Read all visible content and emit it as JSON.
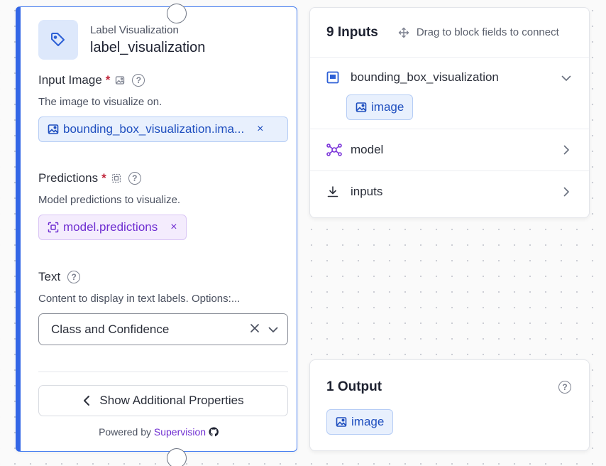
{
  "block": {
    "type_label": "Label Visualization",
    "name": "label_visualization",
    "fields": {
      "input_image": {
        "label": "Input Image",
        "required_mark": "*",
        "description": "The image to visualize on.",
        "value": "bounding_box_visualization.ima...",
        "remove": "×"
      },
      "predictions": {
        "label": "Predictions",
        "required_mark": "*",
        "description": "Model predictions to visualize.",
        "value": "model.predictions",
        "remove": "×"
      },
      "text": {
        "label": "Text",
        "description": "Content to display in text labels. Options:...",
        "value": "Class and Confidence"
      }
    },
    "help_glyph": "?",
    "show_more_label": "Show Additional Properties",
    "powered_by_prefix": "Powered by",
    "powered_by_name": "Supervision"
  },
  "inputs_panel": {
    "title": "9 Inputs",
    "hint": "Drag to block fields to connect",
    "rows": [
      {
        "label": "bounding_box_visualization",
        "icon": "image-icon",
        "expanded": true,
        "chip": "image"
      },
      {
        "label": "model",
        "icon": "model-graph-icon",
        "expanded": false
      },
      {
        "label": "inputs",
        "icon": "download-icon",
        "expanded": false
      }
    ]
  },
  "output_panel": {
    "title": "1 Output",
    "chip": "image"
  },
  "colors": {
    "accent_blue": "#3366e6",
    "chip_blue_text": "#1f4fbf",
    "chip_purple_text": "#6f2ed1",
    "required_red": "#c0253a"
  }
}
